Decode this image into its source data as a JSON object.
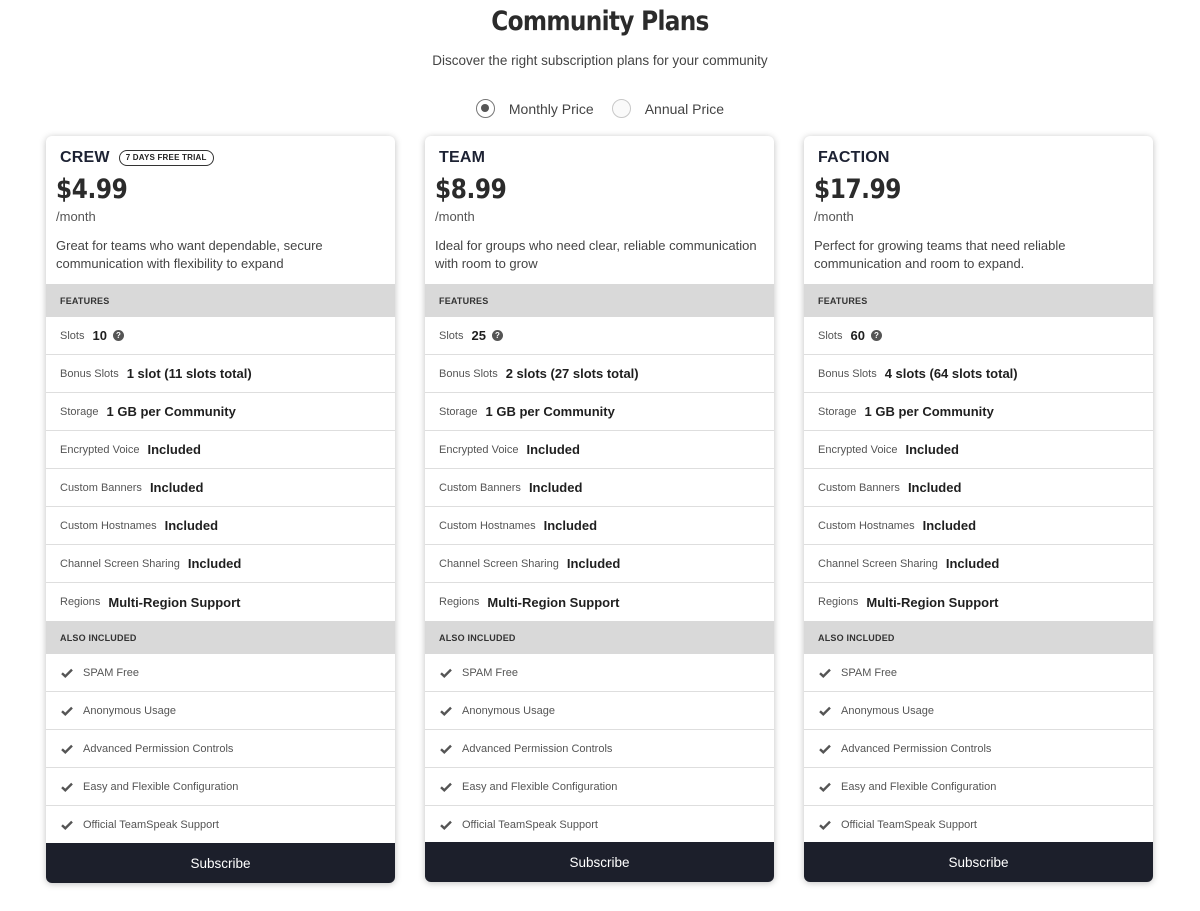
{
  "header": {
    "title": "Community Plans",
    "subtitle": "Discover the right subscription plans for your community"
  },
  "billing_toggle": {
    "options": [
      {
        "label": "Monthly Price",
        "selected": true
      },
      {
        "label": "Annual Price",
        "selected": false
      }
    ]
  },
  "labels": {
    "features_heading": "FEATURES",
    "also_included_heading": "ALSO INCLUDED",
    "subscribe": "Subscribe",
    "help_glyph": "?"
  },
  "feature_labels": {
    "slots": "Slots",
    "bonus_slots": "Bonus Slots",
    "storage": "Storage",
    "encrypted_voice": "Encrypted Voice",
    "custom_banners": "Custom Banners",
    "custom_hostnames": "Custom Hostnames",
    "channel_screen_sharing": "Channel Screen Sharing",
    "regions": "Regions"
  },
  "also_included": [
    "SPAM Free",
    "Anonymous Usage",
    "Advanced Permission Controls",
    "Easy and Flexible Configuration",
    "Official TeamSpeak Support"
  ],
  "colors": {
    "button_bg": "#1c1f2b",
    "section_bg": "#d9d9d9",
    "plan_name": "#1d2233"
  },
  "plans": [
    {
      "name": "CREW",
      "badge": "7 DAYS FREE TRIAL",
      "price": "$4.99",
      "period": "/month",
      "description": "Great for teams who want dependable, secure communication with flexibility to expand",
      "features": {
        "slots": "10",
        "bonus_slots": "1 slot (11 slots total)",
        "storage": "1 GB per Community",
        "encrypted_voice": "Included",
        "custom_banners": "Included",
        "custom_hostnames": "Included",
        "channel_screen_sharing": "Included",
        "regions": "Multi-Region Support"
      }
    },
    {
      "name": "TEAM",
      "badge": "",
      "price": "$8.99",
      "period": "/month",
      "description": "Ideal for groups who need clear, reliable communication with room to grow",
      "features": {
        "slots": "25",
        "bonus_slots": "2 slots (27 slots total)",
        "storage": "1 GB per Community",
        "encrypted_voice": "Included",
        "custom_banners": "Included",
        "custom_hostnames": "Included",
        "channel_screen_sharing": "Included",
        "regions": "Multi-Region Support"
      }
    },
    {
      "name": "FACTION",
      "badge": "",
      "price": "$17.99",
      "period": "/month",
      "description": "Perfect for growing teams that need reliable communication and room to expand.",
      "features": {
        "slots": "60",
        "bonus_slots": "4 slots (64 slots total)",
        "storage": "1 GB per Community",
        "encrypted_voice": "Included",
        "custom_banners": "Included",
        "custom_hostnames": "Included",
        "channel_screen_sharing": "Included",
        "regions": "Multi-Region Support"
      }
    }
  ]
}
